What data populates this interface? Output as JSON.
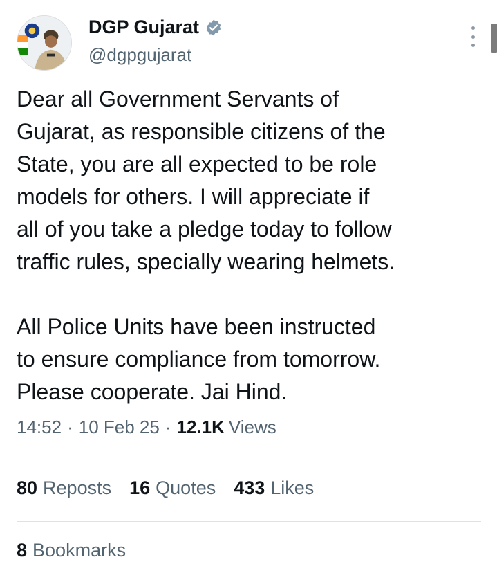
{
  "author": {
    "display_name": "DGP Gujarat",
    "handle": "@dgpgujarat",
    "verified_color": "#829aab"
  },
  "tweet": {
    "text": "Dear all Government Servants of\nGujarat, as responsible citizens of the\nState, you are all expected to be role\nmodels for others. I will appreciate if\nall of you take a pledge today to follow\ntraffic rules, specially wearing helmets.\n\nAll Police Units have been instructed\nto ensure compliance from tomorrow.\nPlease cooperate. Jai Hind.",
    "time": "14:52",
    "date": "10 Feb 25",
    "views_count": "12.1K",
    "views_label": "Views",
    "separator": "·"
  },
  "stats": {
    "reposts_count": "80",
    "reposts_label": "Reposts",
    "quotes_count": "16",
    "quotes_label": "Quotes",
    "likes_count": "433",
    "likes_label": "Likes",
    "bookmarks_count": "8",
    "bookmarks_label": "Bookmarks"
  },
  "icons": {
    "avatar": "profile-photo",
    "verified": "verified-badge-icon",
    "more": "more-options-icon"
  }
}
